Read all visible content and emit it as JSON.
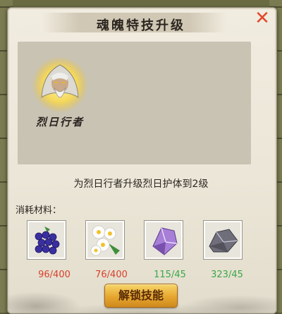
{
  "dialog": {
    "title": "魂魄特技升级",
    "close_icon": "close-x-icon"
  },
  "hero": {
    "name": "烈日行者",
    "portrait_icon": "white-haired-sage-portrait"
  },
  "description": "为烈日行者升级烈日护体到2级",
  "cost_label": "消耗材料：",
  "materials": [
    {
      "icon": "purple-berries-icon",
      "count": "96/400",
      "status": "insufficient"
    },
    {
      "icon": "white-flowers-icon",
      "count": "76/400",
      "status": "insufficient"
    },
    {
      "icon": "purple-crystal-icon",
      "count": "115/45",
      "status": "sufficient"
    },
    {
      "icon": "grey-ore-icon",
      "count": "323/45",
      "status": "sufficient"
    }
  ],
  "unlock_button": "解锁技能",
  "colors": {
    "insufficient": "#d8402c",
    "sufficient": "#3aa84a",
    "close": "#e04a2c",
    "button": "#e6a62f"
  }
}
